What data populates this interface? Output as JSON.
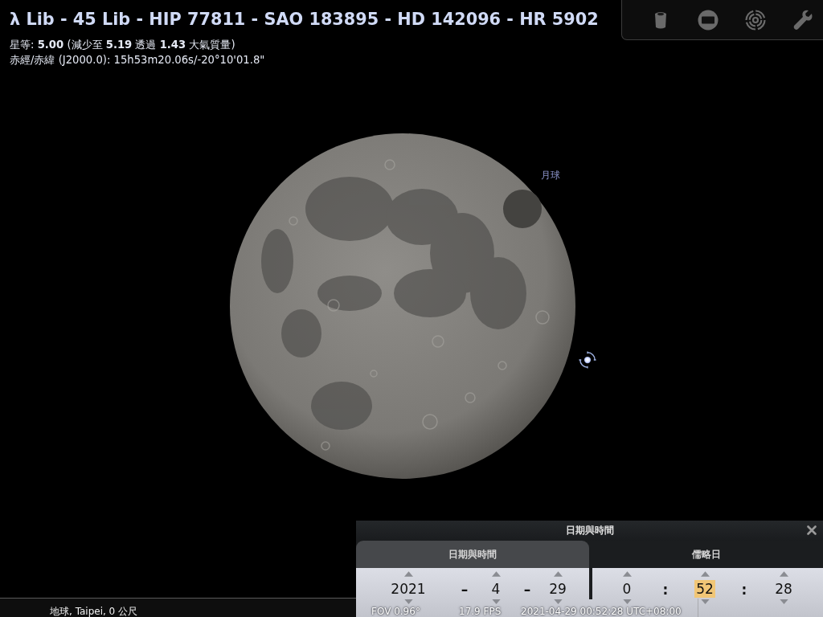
{
  "title": "λ Lib - 45 Lib - HIP 77811 - SAO 183895 - HD 142096 - HR 5902",
  "info_lines": [
    "星等: **5.00** (減少至 **5.19** 透過 **1.43** 大氣質量)",
    "赤經/赤緯 (J2000.0): 15h53m20.06s/-20°10'01.8\""
  ],
  "moon": {
    "label": "月球"
  },
  "status_bar": {
    "location": "地球, Taipei, 0 公尺",
    "fov": "FOV 0.96°",
    "fps": "17.9 FPS",
    "datetime": "2021-04-29 00:52:28 UTC+08:00"
  },
  "dialog": {
    "title": "日期與時間",
    "tabs": [
      {
        "label": "日期與時間",
        "selected": true
      },
      {
        "label": "儒略日",
        "selected": false
      }
    ],
    "date": [
      {
        "kind": "field",
        "value": "2021",
        "selected": false
      },
      {
        "kind": "separator",
        "text": "–"
      },
      {
        "kind": "field",
        "value": "4",
        "selected": false
      },
      {
        "kind": "separator",
        "text": "–"
      },
      {
        "kind": "field",
        "value": "29",
        "selected": false
      }
    ],
    "time": [
      {
        "kind": "field",
        "value": "0",
        "selected": false
      },
      {
        "kind": "separator",
        "text": ":"
      },
      {
        "kind": "field",
        "value": "52",
        "selected": true
      },
      {
        "kind": "separator",
        "text": ":"
      },
      {
        "kind": "field",
        "value": "28",
        "selected": false
      }
    ]
  }
}
